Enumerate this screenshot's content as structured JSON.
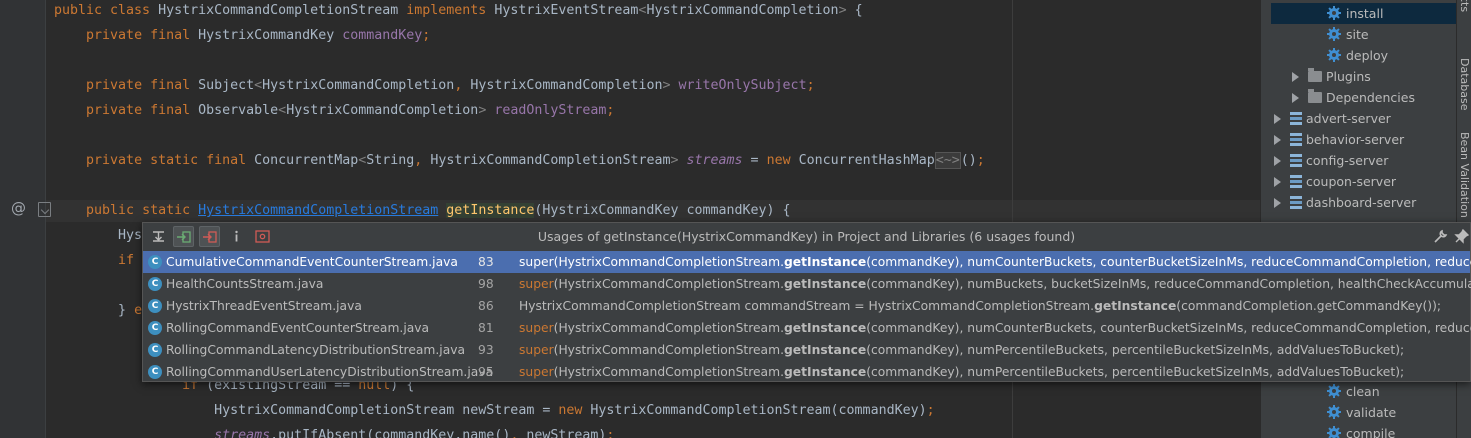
{
  "editor": {
    "lines": [
      {
        "id": "l1",
        "parts": [
          [
            "kw",
            "public class "
          ],
          [
            "",
            "HystrixCommandCompletionStream "
          ],
          [
            "kw",
            "implements "
          ],
          [
            "",
            "HystrixEventStream"
          ],
          [
            "dim",
            "<"
          ],
          [
            "",
            "HystrixCommandCompletion"
          ],
          [
            "dim",
            "> "
          ],
          [
            "",
            "{"
          ]
        ]
      },
      {
        "id": "l2",
        "parts": [
          [
            "",
            "    "
          ],
          [
            "kw",
            "private final "
          ],
          [
            "",
            "HystrixCommandKey "
          ],
          [
            "fld",
            "commandKey"
          ],
          [
            "kw",
            ";"
          ]
        ]
      },
      {
        "id": "l3",
        "parts": [
          [
            "",
            "    "
          ],
          [
            "kw",
            "private final "
          ],
          [
            "",
            "Subject"
          ],
          [
            "dim",
            "<"
          ],
          [
            "",
            "HystrixCommandCompletion"
          ],
          [
            "kw",
            ", "
          ],
          [
            "",
            "HystrixCommandCompletion"
          ],
          [
            "dim",
            "> "
          ],
          [
            "fld",
            "writeOnlySubject"
          ],
          [
            "kw",
            ";"
          ]
        ]
      },
      {
        "id": "l4",
        "parts": [
          [
            "",
            "    "
          ],
          [
            "kw",
            "private final "
          ],
          [
            "",
            "Observable"
          ],
          [
            "dim",
            "<"
          ],
          [
            "",
            "HystrixCommandCompletion"
          ],
          [
            "dim",
            "> "
          ],
          [
            "fld",
            "readOnlyStream"
          ],
          [
            "kw",
            ";"
          ]
        ]
      },
      {
        "id": "l5",
        "parts": [
          [
            "",
            "    "
          ],
          [
            "kw",
            "private static final "
          ],
          [
            "",
            "ConcurrentMap"
          ],
          [
            "dim",
            "<"
          ],
          [
            "",
            "String"
          ],
          [
            "kw",
            ", "
          ],
          [
            "",
            "HystrixCommandCompletionStream"
          ],
          [
            "dim",
            "> "
          ],
          [
            "ifld",
            "streams"
          ],
          [
            "",
            " = "
          ],
          [
            "kw",
            "new "
          ],
          [
            "",
            "ConcurrentHashMap"
          ],
          [
            "dia",
            "<~>"
          ],
          [
            "",
            "()"
          ],
          [
            "kw",
            ";"
          ]
        ]
      },
      {
        "id": "l6",
        "parts": [
          [
            "",
            "    "
          ],
          [
            "kw",
            "public static "
          ],
          [
            "lnk",
            "HystrixCommandCompletionStream"
          ],
          [
            "",
            " "
          ],
          [
            "meth getinst-hl",
            "getInstance"
          ],
          [
            "",
            "(HystrixCommandKey commandKey) {"
          ]
        ]
      },
      {
        "id": "l7",
        "parts": [
          [
            "",
            "        Hys"
          ]
        ]
      },
      {
        "id": "l8",
        "parts": [
          [
            "",
            "        "
          ],
          [
            "kw",
            "if"
          ]
        ]
      },
      {
        "id": "l9",
        "parts": [
          [
            "",
            "        } "
          ],
          [
            "kw",
            "e"
          ]
        ]
      },
      {
        "id": "l10",
        "parts": [
          [
            "",
            "                "
          ],
          [
            "kw",
            "if "
          ],
          [
            "",
            "(existingStream == "
          ],
          [
            "kw",
            "null"
          ],
          [
            "",
            ") {"
          ]
        ]
      },
      {
        "id": "l11",
        "parts": [
          [
            "",
            "                    HystrixCommandCompletionStream newStream = "
          ],
          [
            "kw",
            "new "
          ],
          [
            "",
            "HystrixCommandCompletionStream(commandKey)"
          ],
          [
            "kw",
            ";"
          ]
        ]
      },
      {
        "id": "l12",
        "parts": [
          [
            "",
            "                    "
          ],
          [
            "ifld",
            "streams"
          ],
          [
            "",
            ".putIfAbsent(commandKey.name()"
          ],
          [
            "kw",
            ", "
          ],
          [
            "",
            "newStream)"
          ],
          [
            "kw",
            ";"
          ]
        ]
      }
    ]
  },
  "maven_panel": {
    "top_tab_fragment": "cts",
    "items": [
      {
        "label": "install",
        "icon": "gear-icon",
        "selected": true
      },
      {
        "label": "site",
        "icon": "gear-icon"
      },
      {
        "label": "deploy",
        "icon": "gear-icon"
      },
      {
        "label": "Plugins",
        "icon": "folder-icon",
        "expandable": true
      },
      {
        "label": "Dependencies",
        "icon": "folder-icon",
        "expandable": true
      },
      {
        "label": "advert-server",
        "icon": "module-icon",
        "expandable": true
      },
      {
        "label": "behavior-server",
        "icon": "module-icon",
        "expandable": true
      },
      {
        "label": "config-server",
        "icon": "module-icon",
        "expandable": true
      },
      {
        "label": "coupon-server",
        "icon": "module-icon",
        "expandable": true
      },
      {
        "label": "dashboard-server",
        "icon": "module-icon",
        "expandable": true
      },
      {
        "label": "clean",
        "icon": "gear-icon"
      },
      {
        "label": "validate",
        "icon": "gear-icon"
      },
      {
        "label": "compile",
        "icon": "gear-icon"
      }
    ],
    "side_tabs": [
      "Database",
      "Bean Validation"
    ]
  },
  "usages_popup": {
    "title": "Usages of getInstance(HystrixCommandKey) in Project and Libraries (6 usages found)",
    "rows": [
      {
        "file": "CumulativeCommandEventCounterStream.java",
        "line": "83",
        "pre": "super",
        "mid": "(HystrixCommandCompletionStream.",
        "method": "getInstance",
        "post": "(commandKey), numCounterBuckets, counterBucketSizeInMs, reduceCommandCompletion, reduceBucket);",
        "selected": true
      },
      {
        "file": "HealthCountsStream.java",
        "line": "98",
        "pre": "super",
        "mid": "(HystrixCommandCompletionStream.",
        "method": "getInstance",
        "post": "(commandKey), numBuckets, bucketSizeInMs, reduceCommandCompletion, healthCheckAccumulator);"
      },
      {
        "file": "HystrixThreadEventStream.java",
        "line": "86",
        "pre": "",
        "mid": "HystrixCommandCompletionStream commandStream = HystrixCommandCompletionStream.",
        "method": "getInstance",
        "post": "(commandCompletion.getCommandKey());"
      },
      {
        "file": "RollingCommandEventCounterStream.java",
        "line": "81",
        "pre": "super",
        "mid": "(HystrixCommandCompletionStream.",
        "method": "getInstance",
        "post": "(commandKey), numCounterBuckets, counterBucketSizeInMs, reduceCommandCompletion, reduceBucket);"
      },
      {
        "file": "RollingCommandLatencyDistributionStream.java",
        "line": "93",
        "pre": "super",
        "mid": "(HystrixCommandCompletionStream.",
        "method": "getInstance",
        "post": "(commandKey), numPercentileBuckets, percentileBucketSizeInMs, addValuesToBucket);"
      },
      {
        "file": "RollingCommandUserLatencyDistributionStream.java",
        "line": "95",
        "pre": "super",
        "mid": "(HystrixCommandCompletionStream.",
        "method": "getInstance",
        "post": "(commandKey), numPercentileBuckets, percentileBucketSizeInMs, addValuesToBucket);"
      }
    ],
    "class_icon_letter": "C"
  },
  "gutter": {
    "at_symbol": "@"
  }
}
